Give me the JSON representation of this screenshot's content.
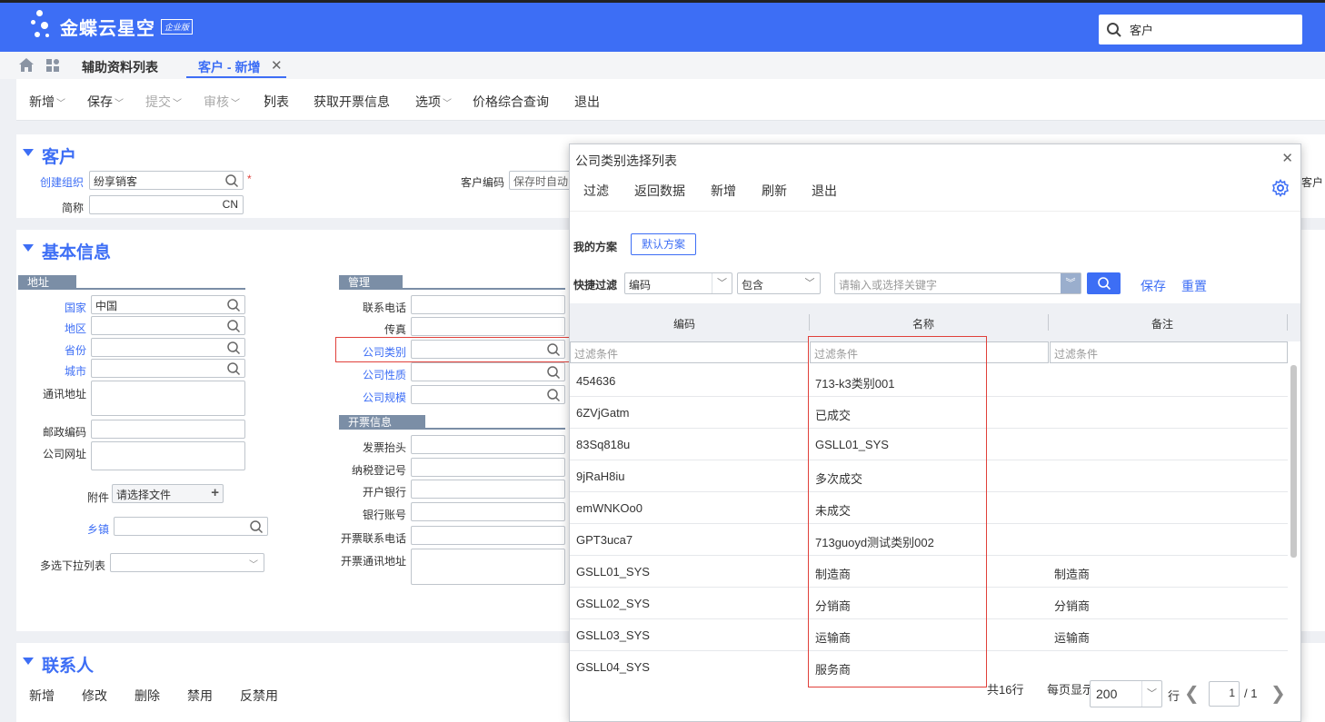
{
  "header": {
    "brand": "金蝶云星空",
    "brand_badge": "企业版",
    "search_value": "客户"
  },
  "tabs": [
    {
      "label": "辅助资料列表"
    },
    {
      "label": "客户 - 新增",
      "active": true
    }
  ],
  "toolbar": {
    "items": [
      "新增",
      "保存",
      "提交",
      "审核",
      "列表",
      "获取开票信息",
      "选项",
      "价格综合查询",
      "退出"
    ]
  },
  "customer_section": {
    "title": "客户",
    "create_org_label": "创建组织",
    "create_org_value": "纷享销客",
    "required_mark": "*",
    "short_name_label": "简称",
    "short_name_suffix": "CN",
    "customer_code_label": "客户编码",
    "customer_code_value": "保存时自动",
    "cut_label": "客户"
  },
  "basic_section": {
    "title": "基本信息",
    "address_group": "地址",
    "country_label": "国家",
    "country_value": "中国",
    "region_label": "地区",
    "province_label": "省份",
    "city_label": "城市",
    "mail_addr_label": "通讯地址",
    "postcode_label": "邮政编码",
    "website_label": "公司网址",
    "attach_label": "附件",
    "attach_placeholder": "请选择文件",
    "town_label": "乡镇",
    "multi_select_label": "多选下拉列表",
    "manage_group": "管理",
    "phone_label": "联系电话",
    "fax_label": "传真",
    "company_type_label": "公司类别",
    "company_nature_label": "公司性质",
    "company_scale_label": "公司规模",
    "invoice_group": "开票信息",
    "invoice_title_label": "发票抬头",
    "tax_no_label": "纳税登记号",
    "bank_label": "开户银行",
    "account_label": "银行账号",
    "invoice_phone_label": "开票联系电话",
    "invoice_addr_label": "开票通讯地址"
  },
  "contact_section": {
    "title": "联系人",
    "actions": [
      "新增",
      "修改",
      "删除",
      "禁用",
      "反禁用"
    ]
  },
  "dialog": {
    "title": "公司类别选择列表",
    "toolbar": [
      "过滤",
      "返回数据",
      "新增",
      "刷新",
      "退出"
    ],
    "my_scheme_label": "我的方案",
    "default_scheme": "默认方案",
    "quick_filter_label": "快捷过滤",
    "field_select": "编码",
    "op_select": "包含",
    "keyword_placeholder": "请输入或选择关键字",
    "save_link": "保存",
    "reset_link": "重置",
    "columns": [
      "编码",
      "名称",
      "备注"
    ],
    "filter_placeholder": "过滤条件",
    "rows": [
      {
        "code": "454636",
        "name": "713-k3类别001",
        "remark": ""
      },
      {
        "code": "6ZVjGatm",
        "name": "已成交",
        "remark": ""
      },
      {
        "code": "83Sq818u",
        "name": "GSLL01_SYS",
        "remark": ""
      },
      {
        "code": "9jRaH8iu",
        "name": "多次成交",
        "remark": ""
      },
      {
        "code": "emWNKOo0",
        "name": "未成交",
        "remark": ""
      },
      {
        "code": "GPT3uca7",
        "name": "713guoyd测试类别002",
        "remark": ""
      },
      {
        "code": "GSLL01_SYS",
        "name": "制造商",
        "remark": "制造商"
      },
      {
        "code": "GSLL02_SYS",
        "name": "分销商",
        "remark": "分销商"
      },
      {
        "code": "GSLL03_SYS",
        "name": "运输商",
        "remark": "运输商"
      },
      {
        "code": "GSLL04_SYS",
        "name": "服务商",
        "remark": ""
      }
    ],
    "pager": {
      "total": "共16行",
      "per_page_label": "每页显示",
      "per_page_value": "200",
      "row_unit": "行",
      "page": "1",
      "total_pages": "/ 1"
    }
  }
}
